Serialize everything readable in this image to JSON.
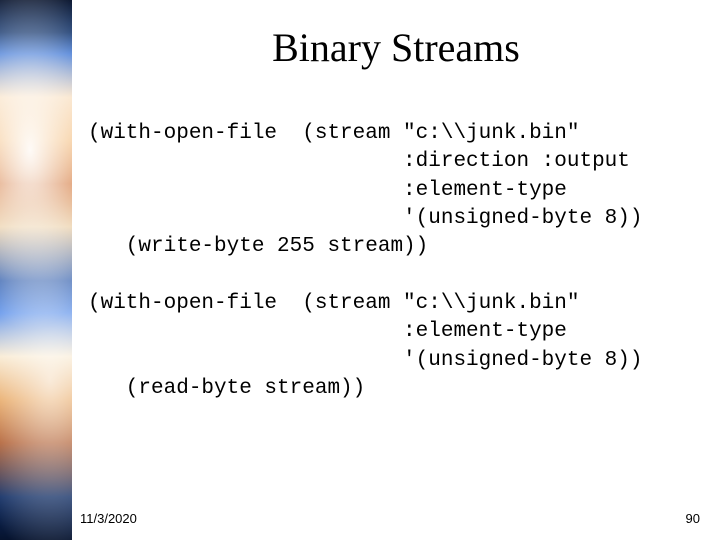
{
  "title": "Binary Streams",
  "code_block_1": "(with-open-file  (stream \"c:\\\\junk.bin\"\n                         :direction :output\n                         :element-type\n                         '(unsigned-byte 8))\n   (write-byte 255 stream))",
  "code_block_2": "(with-open-file  (stream \"c:\\\\junk.bin\"\n                         :element-type\n                         '(unsigned-byte 8))\n   (read-byte stream))",
  "footer": {
    "date": "11/3/2020",
    "page": "90"
  }
}
